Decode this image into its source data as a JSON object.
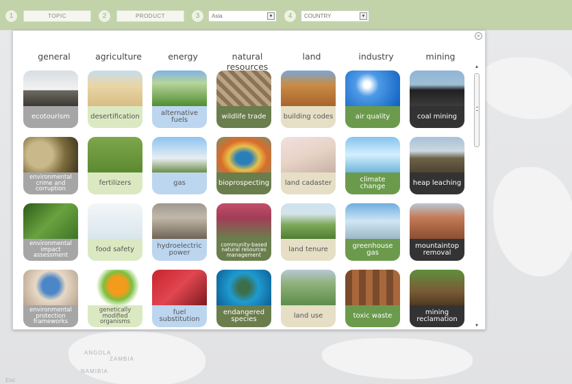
{
  "filters": {
    "steps": [
      "1",
      "2",
      "3",
      "4"
    ],
    "topic": "TOPIC",
    "product": "PRODUCT",
    "region": "Asia",
    "country": "COUNTRY"
  },
  "map_labels": [
    "ANGOLA",
    "ZAMBIA",
    "NAMIBIA",
    "Esri"
  ],
  "modal": {
    "close_icon": "close-icon",
    "columns": [
      "general",
      "agriculture",
      "energy",
      "natural resources",
      "land",
      "industry",
      "mining"
    ],
    "column_colors": [
      "#a6a6a6",
      "#dbe9c2",
      "#bcd6f0",
      "#6a7d4c",
      "#e6dfc6",
      "#6b9a4c",
      "#333333"
    ],
    "caption_text_colors": [
      "#ffffff",
      "#555555",
      "#555555",
      "#ffffff",
      "#555555",
      "#ffffff",
      "#ffffff"
    ],
    "rows": [
      [
        {
          "label": "ecotourism",
          "icon": "hikers-silhouette-icon"
        },
        {
          "label": "desertification",
          "icon": "sand-dune-icon"
        },
        {
          "label": "alternative fuels",
          "icon": "corn-field-icon"
        },
        {
          "label": "wildlife trade",
          "icon": "snakeskin-icon"
        },
        {
          "label": "building codes",
          "icon": "house-frame-icon"
        },
        {
          "label": "air quality",
          "icon": "blue-sky-icon"
        },
        {
          "label": "coal mining",
          "icon": "coal-pile-icon"
        }
      ],
      [
        {
          "label": "environmental crime and corruption",
          "icon": "pipe-discharge-icon"
        },
        {
          "label": "fertilizers",
          "icon": "farmer-spraying-icon"
        },
        {
          "label": "gas",
          "icon": "storage-tanks-icon"
        },
        {
          "label": "bioprospecting",
          "icon": "hot-spring-icon"
        },
        {
          "label": "land cadaster",
          "icon": "survey-map-icon"
        },
        {
          "label": "climate change",
          "icon": "melting-ice-icon"
        },
        {
          "label": "heap leaching",
          "icon": "leach-pond-icon"
        }
      ],
      [
        {
          "label": "environmental impact assessment",
          "icon": "leaf-icon"
        },
        {
          "label": "food safety",
          "icon": "gloved-hands-grapes-icon"
        },
        {
          "label": "hydroelectric power",
          "icon": "dam-icon"
        },
        {
          "label": "community-based natural resources management",
          "icon": "community-group-icon"
        },
        {
          "label": "land tenure",
          "icon": "fenced-field-icon"
        },
        {
          "label": "greenhouse gas",
          "icon": "smokestacks-icon"
        },
        {
          "label": "mountaintop removal",
          "icon": "open-pit-mine-icon"
        }
      ],
      [
        {
          "label": "environmental protection frameworks",
          "icon": "earth-in-hands-icon"
        },
        {
          "label": "genetically modified organisms",
          "icon": "oranges-kiwi-icon"
        },
        {
          "label": "fuel substitution",
          "icon": "fuel-nozzle-icon"
        },
        {
          "label": "endangered species",
          "icon": "sea-turtle-icon"
        },
        {
          "label": "land use",
          "icon": "aerial-fields-icon"
        },
        {
          "label": "toxic waste",
          "icon": "waste-barrels-icon"
        },
        {
          "label": "mining reclamation",
          "icon": "planting-seedling-icon"
        }
      ]
    ]
  },
  "scrollbar": {
    "up_icon": "scroll-up-arrow-icon",
    "down_icon": "scroll-down-arrow-icon"
  }
}
